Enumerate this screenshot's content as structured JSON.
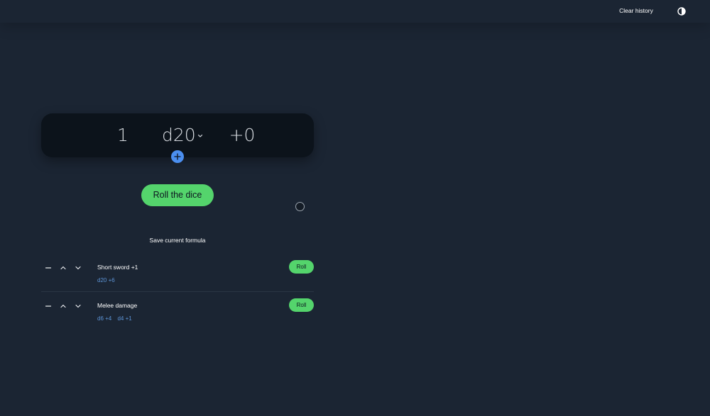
{
  "header": {
    "clear_history_label": "Clear history",
    "theme_toggle_icon": "half-circle-contrast-icon"
  },
  "formula": {
    "count": "1",
    "die": "d20",
    "die_dropdown_icon": "chevron-down-icon",
    "modifier": "+0",
    "add_die_icon": "plus-icon"
  },
  "roll_button_label": "Roll the dice",
  "save_formula_label": "Save current formula",
  "saved_formulas": [
    {
      "name": "Short sword +1",
      "parts": [
        "d20 +6"
      ],
      "roll_label": "Roll"
    },
    {
      "name": "Melee damage",
      "parts": [
        "d6 +4",
        "d4 +1"
      ],
      "roll_label": "Roll"
    }
  ],
  "colors": {
    "background": "#1b2533",
    "card": "#0c131b",
    "accent_green": "#54d46c",
    "accent_blue": "#4b8ff0",
    "link_blue": "#5d94d6"
  }
}
